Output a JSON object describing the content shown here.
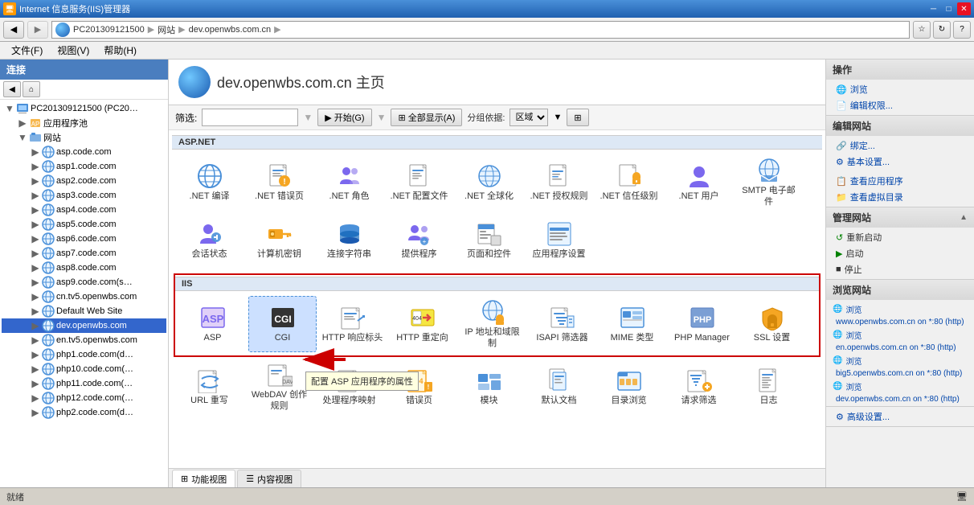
{
  "titlebar": {
    "title": "Internet 信息服务(IIS)管理器",
    "min": "─",
    "max": "□",
    "close": "✕"
  },
  "addressbar": {
    "back_tooltip": "后退",
    "forward_tooltip": "前进",
    "breadcrumb": [
      "PC201309121500",
      "网站",
      "dev.openwbs.com.cn"
    ],
    "refresh": "↻",
    "help": "?"
  },
  "menubar": {
    "items": [
      "文件(F)",
      "视图(V)",
      "帮助(H)"
    ]
  },
  "sidebar": {
    "header": "连接",
    "tree": [
      {
        "label": "PC201309121500 (PC20…",
        "level": 0,
        "expanded": true,
        "type": "server"
      },
      {
        "label": "应用程序池",
        "level": 1,
        "expanded": false,
        "type": "folder"
      },
      {
        "label": "网站",
        "level": 1,
        "expanded": true,
        "type": "folder"
      },
      {
        "label": "asp.code.com",
        "level": 2,
        "expanded": false,
        "type": "site"
      },
      {
        "label": "asp1.code.com",
        "level": 2,
        "expanded": false,
        "type": "site"
      },
      {
        "label": "asp2.code.com",
        "level": 2,
        "expanded": false,
        "type": "site"
      },
      {
        "label": "asp3.code.com",
        "level": 2,
        "expanded": false,
        "type": "site"
      },
      {
        "label": "asp4.code.com",
        "level": 2,
        "expanded": false,
        "type": "site"
      },
      {
        "label": "asp5.code.com",
        "level": 2,
        "expanded": false,
        "type": "site"
      },
      {
        "label": "asp6.code.com",
        "level": 2,
        "expanded": false,
        "type": "site"
      },
      {
        "label": "asp7.code.com",
        "level": 2,
        "expanded": false,
        "type": "site"
      },
      {
        "label": "asp8.code.com",
        "level": 2,
        "expanded": false,
        "type": "site"
      },
      {
        "label": "asp9.code.com(s…",
        "level": 2,
        "expanded": false,
        "type": "site"
      },
      {
        "label": "cn.tv5.openwbs.com",
        "level": 2,
        "expanded": false,
        "type": "site"
      },
      {
        "label": "Default Web Site",
        "level": 2,
        "expanded": false,
        "type": "site"
      },
      {
        "label": "dev.openwbs.com",
        "level": 2,
        "expanded": false,
        "type": "site",
        "selected": true
      },
      {
        "label": "en.tv5.openwbs.com",
        "level": 2,
        "expanded": false,
        "type": "site"
      },
      {
        "label": "php1.code.com(d…",
        "level": 2,
        "expanded": false,
        "type": "site"
      },
      {
        "label": "php10.code.com(…",
        "level": 2,
        "expanded": false,
        "type": "site"
      },
      {
        "label": "php11.code.com(…",
        "level": 2,
        "expanded": false,
        "type": "site"
      },
      {
        "label": "php12.code.com(…",
        "level": 2,
        "expanded": false,
        "type": "site"
      },
      {
        "label": "php2.code.com(d…",
        "level": 2,
        "expanded": false,
        "type": "site"
      }
    ]
  },
  "content": {
    "title": "dev.openwbs.com.cn 主页",
    "filter_label": "筛选:",
    "filter_placeholder": "",
    "start_btn": "▶ 开始(G)",
    "show_all_btn": "⊞ 全部显示(A)",
    "group_label": "分组依据:",
    "group_value": "区域",
    "sections": [
      {
        "name": "ASP.NET",
        "icons": [
          {
            "id": "net-compile",
            "label": ".NET 编译",
            "color": "#4a90d9",
            "shape": "globe"
          },
          {
            "id": "net-error",
            "label": ".NET 错误页",
            "color": "#f5a623",
            "shape": "warning-page"
          },
          {
            "id": "net-role",
            "label": ".NET 角色",
            "color": "#7b68ee",
            "shape": "people"
          },
          {
            "id": "net-config",
            "label": ".NET 配置文件",
            "color": "#4a90d9",
            "shape": "page"
          },
          {
            "id": "net-global",
            "label": ".NET 全球化",
            "color": "#4a90d9",
            "shape": "globe"
          },
          {
            "id": "net-auth",
            "label": ".NET 授权规则",
            "color": "#4a90d9",
            "shape": "page"
          },
          {
            "id": "net-trust",
            "label": ".NET 信任级别",
            "color": "#4a90d9",
            "shape": "lock-page"
          },
          {
            "id": "net-user",
            "label": ".NET 用户",
            "color": "#7b68ee",
            "shape": "people"
          },
          {
            "id": "smtp",
            "label": "SMTP 电子邮件",
            "color": "#4a90d9",
            "shape": "envelope"
          },
          {
            "id": "session",
            "label": "会话状态",
            "color": "#7b68ee",
            "shape": "person-gear"
          },
          {
            "id": "machine-key",
            "label": "计算机密钥",
            "color": "#f5a623",
            "shape": "key"
          },
          {
            "id": "connection-str",
            "label": "连接字符串",
            "color": "#4a90d9",
            "shape": "db"
          },
          {
            "id": "providers",
            "label": "提供程序",
            "color": "#7b68ee",
            "shape": "people-gear"
          },
          {
            "id": "pages-controls",
            "label": "页面和控件",
            "color": "#4a90d9",
            "shape": "page-gear"
          },
          {
            "id": "app-settings",
            "label": "应用程序设置",
            "color": "#4a90d9",
            "shape": "page-list"
          }
        ]
      },
      {
        "name": "IIS",
        "icons": [
          {
            "id": "asp",
            "label": "ASP",
            "color": "#7b68ee",
            "shape": "asp"
          },
          {
            "id": "cgi",
            "label": "CGI",
            "color": "#333",
            "shape": "cgi",
            "highlighted": true
          },
          {
            "id": "http-response",
            "label": "HTTP 响应标头",
            "color": "#4a90d9",
            "shape": "arrow-page"
          },
          {
            "id": "http-redirect",
            "label": "HTTP 重定向",
            "color": "#f5a623",
            "shape": "redirect"
          },
          {
            "id": "ip-domain",
            "label": "IP 地址和域限制",
            "color": "#4a90d9",
            "shape": "globe-lock"
          },
          {
            "id": "isapi-filter",
            "label": "ISAPI 筛选器",
            "color": "#4a90d9",
            "shape": "page-filter"
          },
          {
            "id": "mime",
            "label": "MIME 类型",
            "color": "#4a90d9",
            "shape": "page-type"
          },
          {
            "id": "php-manager",
            "label": "PHP Manager",
            "color": "#6a9ad4",
            "shape": "php"
          },
          {
            "id": "ssl",
            "label": "SSL 设置",
            "color": "#f5a623",
            "shape": "lock"
          },
          {
            "id": "url-rewrite",
            "label": "URL 重写",
            "color": "#4a90d9",
            "shape": "rewrite"
          },
          {
            "id": "webdav",
            "label": "WebDAV 创作规则",
            "color": "#4a90d9",
            "shape": "dav"
          },
          {
            "id": "handler",
            "label": "处理程序映射",
            "color": "#4a90d9",
            "shape": "handler"
          },
          {
            "id": "error-pages",
            "label": "错误页",
            "color": "#f5a623",
            "shape": "error-page"
          },
          {
            "id": "modules",
            "label": "模块",
            "color": "#4a90d9",
            "shape": "modules"
          },
          {
            "id": "default-doc",
            "label": "默认文档",
            "color": "#4a90d9",
            "shape": "default-doc"
          },
          {
            "id": "dir-browse",
            "label": "目录浏览",
            "color": "#4a90d9",
            "shape": "folder-browse"
          },
          {
            "id": "request-filter",
            "label": "请求筛选",
            "color": "#4a90d9",
            "shape": "filter"
          },
          {
            "id": "log",
            "label": "日志",
            "color": "#4a90d9",
            "shape": "log"
          }
        ]
      }
    ],
    "tooltip": "配置 ASP 应用程序的属性"
  },
  "rightpanel": {
    "sections": [
      {
        "title": "操作",
        "items": [
          {
            "type": "link",
            "label": "浏览",
            "icon": "browse"
          },
          {
            "type": "link",
            "label": "编辑权限...",
            "icon": "perm"
          }
        ]
      },
      {
        "title": "编辑网站",
        "items": [
          {
            "type": "link",
            "label": "绑定...",
            "icon": "bind"
          },
          {
            "type": "link",
            "label": "基本设置...",
            "icon": "settings"
          },
          {
            "type": "link",
            "label": "查看应用程序",
            "icon": "app"
          },
          {
            "type": "link",
            "label": "查看虚拟目录",
            "icon": "vdir"
          }
        ]
      },
      {
        "title": "管理网站",
        "collapsible": true,
        "items": [
          {
            "type": "action",
            "label": "重新启动",
            "icon": "restart",
            "color": "green"
          },
          {
            "type": "action",
            "label": "启动",
            "icon": "start",
            "color": "green"
          },
          {
            "type": "action",
            "label": "停止",
            "icon": "stop",
            "color": "black"
          }
        ]
      },
      {
        "title": "浏览网站",
        "items": [
          {
            "type": "link",
            "label": "浏览 www.openwbs.com.cn on *:80 (http)",
            "icon": "browse2",
            "color": "#0044aa"
          },
          {
            "type": "link",
            "label": "浏览 en.openwbs.com.cn on *:80 (http)",
            "icon": "browse2"
          },
          {
            "type": "link",
            "label": "浏览 big5.openwbs.com.cn on *:80 (http)",
            "icon": "browse2"
          },
          {
            "type": "link",
            "label": "浏览 dev.openwbs.com.cn on *:80 (http)",
            "icon": "browse2"
          }
        ]
      },
      {
        "title": "",
        "items": [
          {
            "type": "link",
            "label": "高级设置...",
            "icon": "adv"
          }
        ]
      }
    ]
  },
  "statusbar": {
    "text": "就绪"
  },
  "bottomtabs": [
    {
      "label": "功能视图",
      "icon": "grid",
      "active": true
    },
    {
      "label": "内容视图",
      "icon": "content",
      "active": false
    }
  ]
}
